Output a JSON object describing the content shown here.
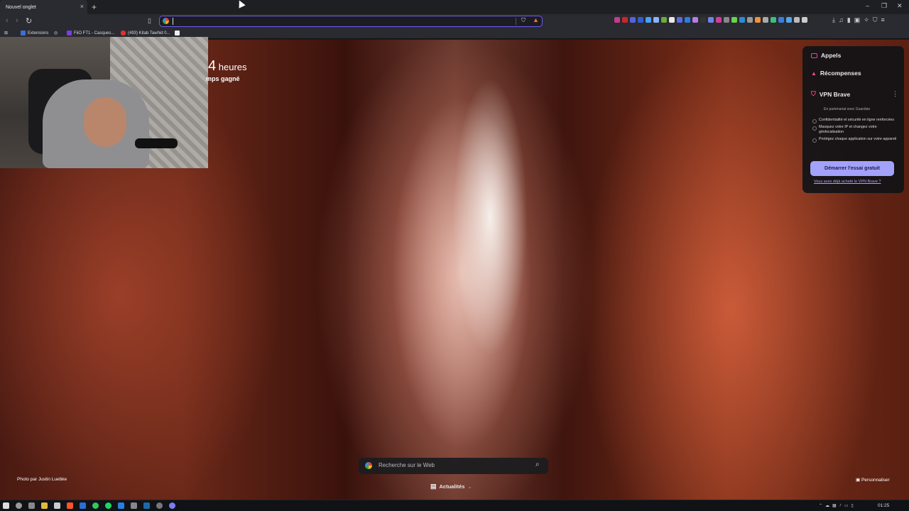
{
  "tab": {
    "title": "Nouvel onglet",
    "close": "×",
    "new": "+"
  },
  "window": {
    "minimize": "–",
    "maximize": "❐",
    "close": "✕"
  },
  "bookmarks": [
    {
      "label": "Extensions"
    },
    {
      "label": "FiiO FT1 - Casques..."
    },
    {
      "label": "(493) Kitab Tawhid 0..."
    }
  ],
  "stats": {
    "value": "4",
    "unit": "heures",
    "sub": "mps gagné"
  },
  "panel": {
    "appels": "Appels",
    "recompenses": "Récompenses",
    "vpn_title": "VPN Brave",
    "partner": "En partenariat avec  Guardian",
    "bullets": [
      "Confidentialité et sécurité en ligne renforcées",
      "Masquez votre IP et changez votre géolocalisation",
      "Protégez chaque application sur votre appareil"
    ],
    "cta": "Démarrer l'essai gratuit",
    "already": "Vous avez déjà acheté le VPN Brave ?"
  },
  "search": {
    "placeholder": "Recherche sur le Web"
  },
  "news": {
    "label": "Actualités"
  },
  "photo_credit": "Photo par Justin Luebke",
  "personalize": "Personnaliser",
  "clock": "01:25",
  "colors": {
    "accent": "#6f5af6",
    "cta": "#a3a2fb"
  }
}
